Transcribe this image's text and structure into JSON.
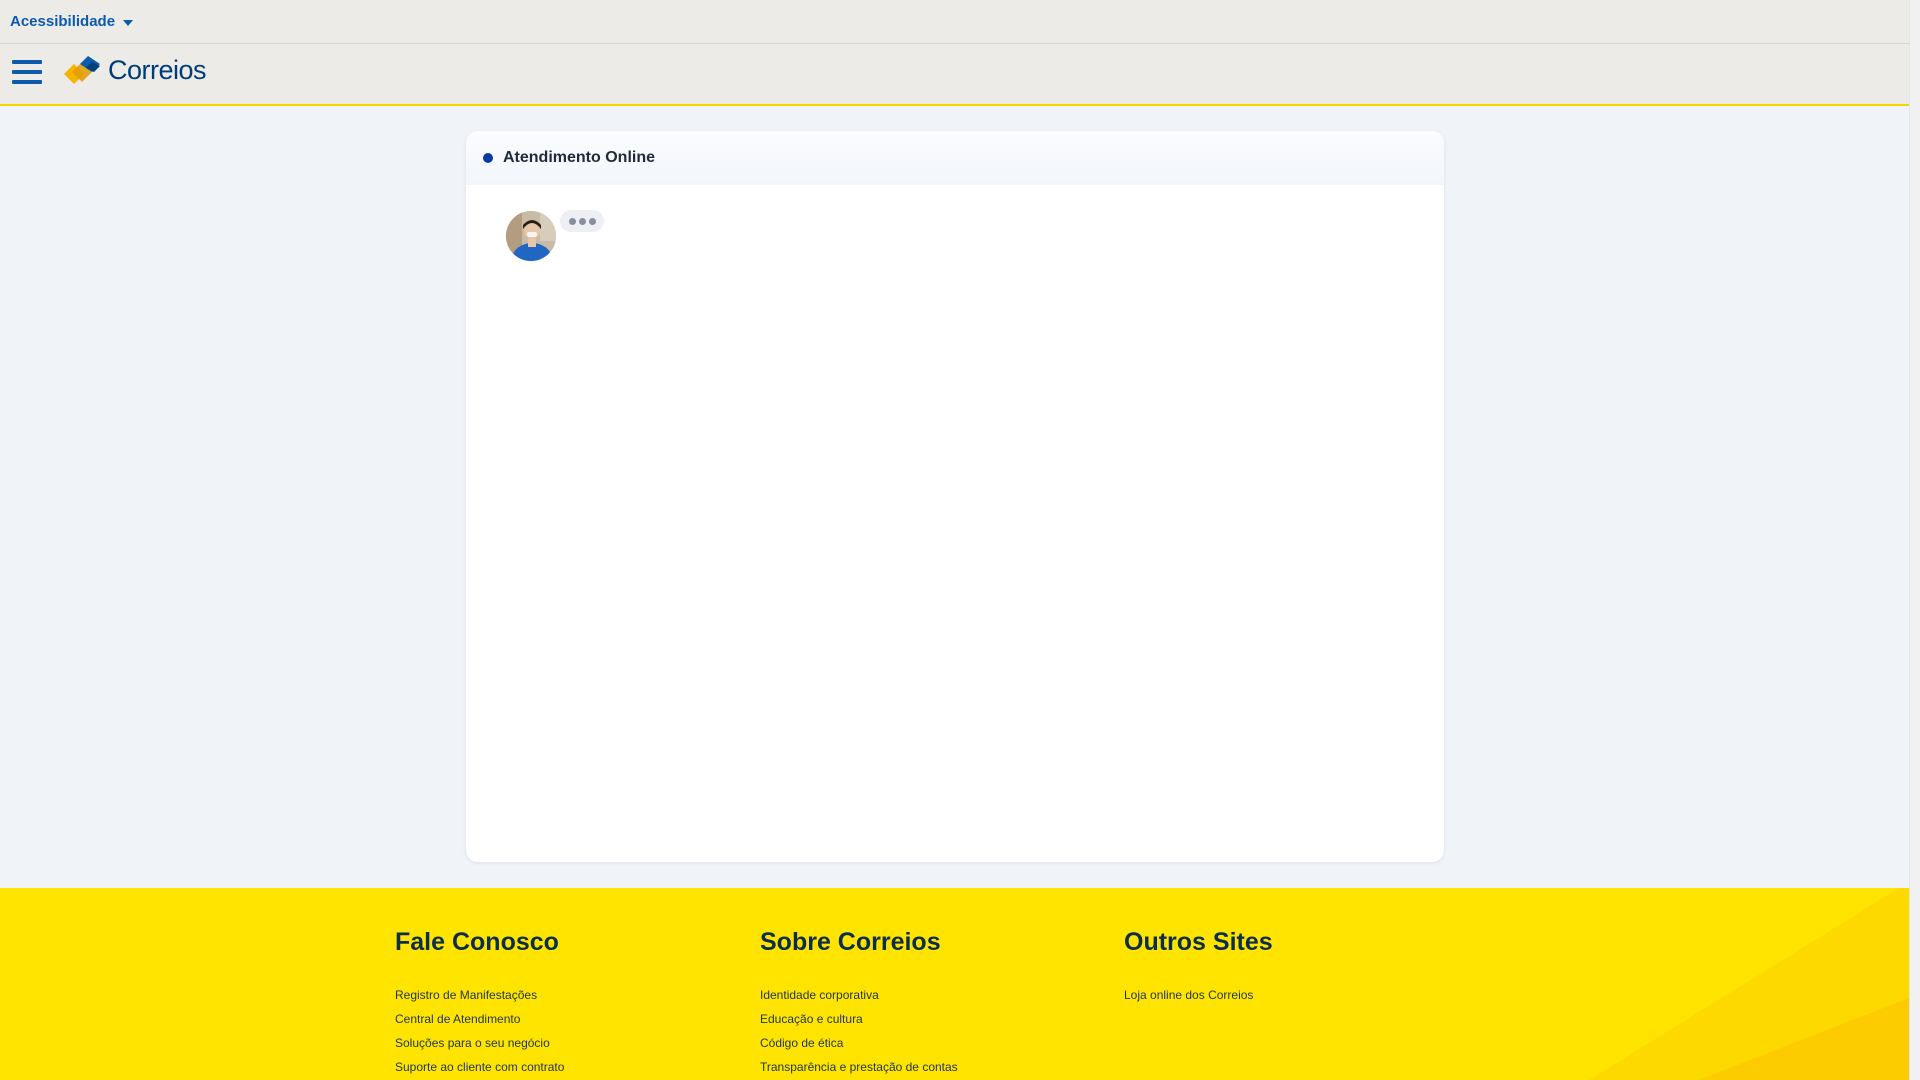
{
  "accessibility": {
    "label": "Acessibilidade"
  },
  "header": {
    "brand": "Correios"
  },
  "chat": {
    "title": "Atendimento Online"
  },
  "footer": {
    "columns": [
      {
        "title": "Fale Conosco",
        "links": [
          "Registro de Manifestações",
          "Central de Atendimento",
          "Soluções para o seu negócio",
          "Suporte ao cliente com contrato"
        ]
      },
      {
        "title": "Sobre Correios",
        "links": [
          "Identidade corporativa",
          "Educação e cultura",
          "Código de ética",
          "Transparência e prestação de contas"
        ]
      },
      {
        "title": "Outros Sites",
        "links": [
          "Loja online dos Correios"
        ]
      }
    ]
  },
  "colors": {
    "brand_blue": "#0b5cad",
    "brand_yellow": "#ffe400",
    "status_online": "#0a3aa0"
  }
}
